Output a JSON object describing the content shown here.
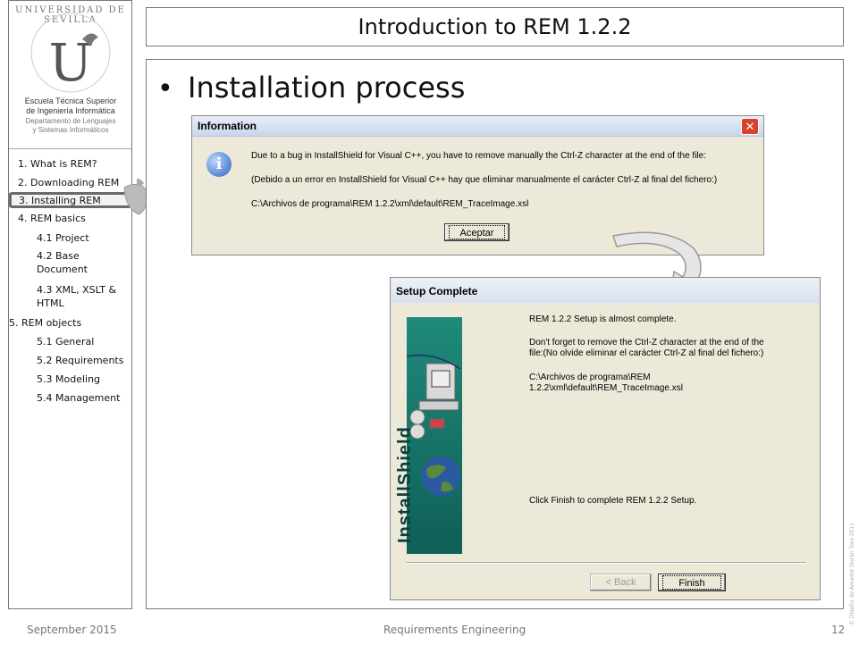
{
  "slide": {
    "title": "Introduction to REM 1.2.2",
    "bullet": "•",
    "heading": "Installation process"
  },
  "sidebar": {
    "seal_text": "UNIVERSIDAD DE SEVILLA",
    "school_line1": "Escuela Técnica Superior",
    "school_line2": "de Ingeniería Informática",
    "dept_line1": "Departamento de Lenguajes",
    "dept_line2": "y Sistemas Informáticos",
    "toc": [
      {
        "label": "1.  What is REM?"
      },
      {
        "label": "2.  Downloading REM"
      },
      {
        "label": "3.  Installing REM",
        "active": true
      },
      {
        "label": "4.  REM basics"
      },
      {
        "label": "4.1 Project"
      },
      {
        "label": "4.2 Base"
      },
      {
        "label": "Document"
      },
      {
        "label": "4.3 XML, XSLT &"
      },
      {
        "label": "HTML"
      },
      {
        "label": "5. REM objects"
      },
      {
        "label": "5.1 General"
      },
      {
        "label": "5.2 Requirements"
      },
      {
        "label": "5.3 Modeling"
      },
      {
        "label": "5.4 Management"
      }
    ]
  },
  "info_dialog": {
    "title": "Information",
    "close": "✕",
    "icon": "i",
    "line1": "Due to a bug in InstallShield for Visual C++, you have to remove manually the Ctrl-Z character at the end of the file:",
    "line2": "(Debido a un error en InstallShield for Visual C++ hay que eliminar manualmente el carácter Ctrl-Z al final del fichero:)",
    "line3": "C:\\Archivos de programa\\REM 1.2.2\\xml\\default\\REM_TraceImage.xsl",
    "ok_label": "Aceptar"
  },
  "setup_dialog": {
    "title": "Setup Complete",
    "panel_text": "InstallShield",
    "line1": "REM 1.2.2 Setup is almost complete.",
    "line2": "Don't forget to remove the Ctrl-Z character at the end of the",
    "line3": "file:(No olvide eliminar el carácter Ctrl-Z al final del fichero:)",
    "line4": "C:\\Archivos de programa\\REM",
    "line5": "1.2.2\\xml\\default\\REM_TraceImage.xsl",
    "line6": "Click Finish to complete REM 1.2.2 Setup.",
    "back_label": "< Back",
    "finish_label": "Finish"
  },
  "footer": {
    "date": "September 2015",
    "course": "Requirements Engineering",
    "page": "12"
  },
  "credit": "© Diseño de Amador Durán Toro 2011"
}
